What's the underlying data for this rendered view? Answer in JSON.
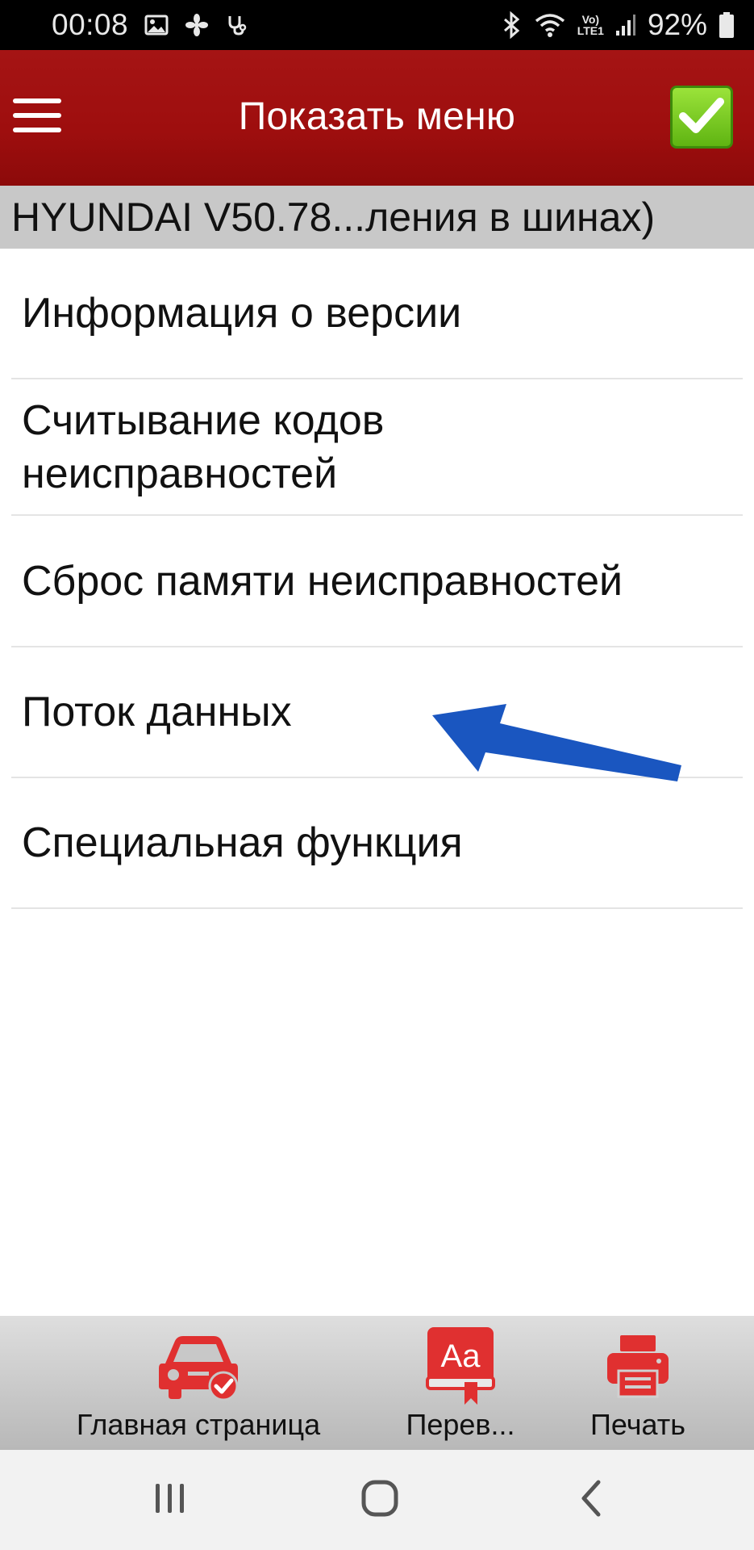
{
  "status_bar": {
    "time": "00:08",
    "battery_percent": "92%",
    "icons": [
      "gallery-icon",
      "fan-icon",
      "stethoscope-icon",
      "bluetooth-icon",
      "wifi-icon",
      "volte-lte-icon",
      "signal-icon",
      "battery-icon"
    ],
    "volte_label": "Vo)",
    "lte_label": "LTE1"
  },
  "header": {
    "title": "Показать меню",
    "accent_color": "#9e0e0e",
    "confirm_color": "#6cc11a"
  },
  "breadcrumb": {
    "text": "HYUNDAI V50.78...ления в шинах)"
  },
  "menu": {
    "items": [
      {
        "label": "Информация о версии"
      },
      {
        "label_line1": "Считывание кодов",
        "label_line2": "неисправностей"
      },
      {
        "label": "Сброс памяти неисправностей"
      },
      {
        "label": "Поток данных"
      },
      {
        "label": "Специальная функция"
      }
    ]
  },
  "annotation": {
    "arrow_color": "#1a56c0",
    "points_to": "Поток данных"
  },
  "toolbar": {
    "home_label": "Главная страница",
    "translate_label": "Перев...",
    "translate_icon_text": "Aa",
    "print_label": "Печать",
    "icon_color": "#e03030"
  },
  "nav_bar": {
    "buttons": [
      "recent-apps",
      "home",
      "back"
    ]
  }
}
